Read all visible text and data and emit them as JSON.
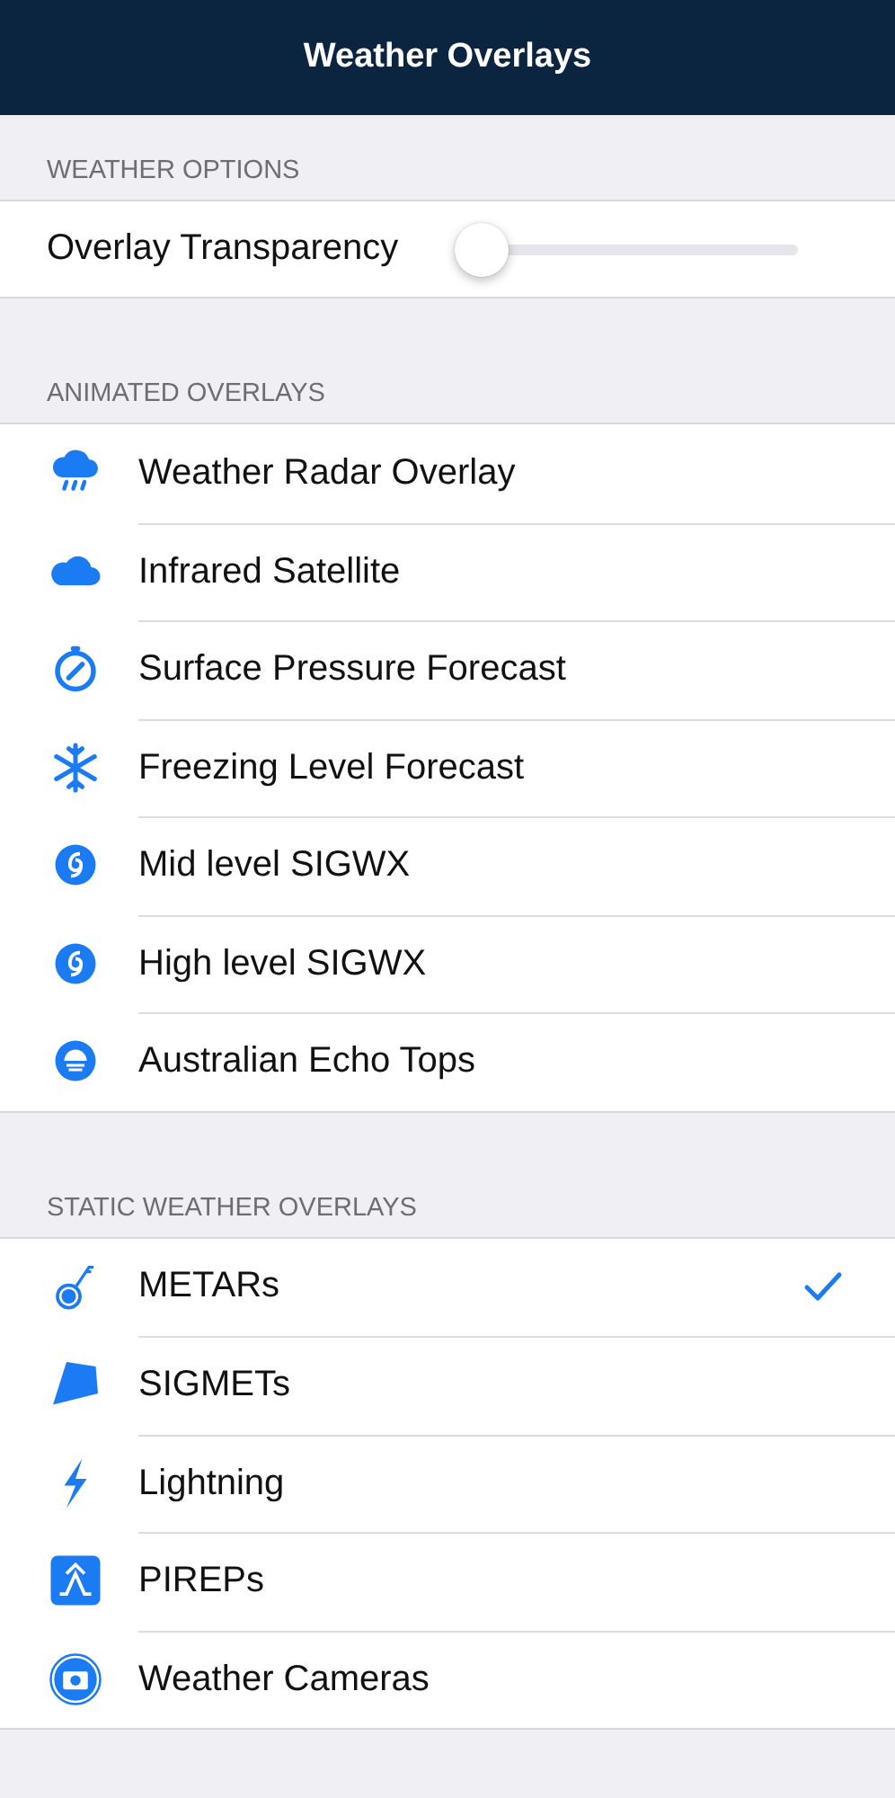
{
  "nav_bar": {
    "title": "Weather Overlays"
  },
  "weather_options": {
    "header": "WEATHER OPTIONS",
    "transparency": {
      "label": "Overlay Transparency",
      "level": 0
    }
  },
  "animated_overlays": {
    "header": "ANIMATED OVERLAYS",
    "items": [
      {
        "label": "Weather Radar Overlay",
        "kind": "rain",
        "checked": false
      },
      {
        "label": "Infrared Satellite",
        "kind": "cloud",
        "checked": false
      },
      {
        "label": "Surface Pressure Forecast",
        "kind": "gauge",
        "checked": false
      },
      {
        "label": "Freezing Level Forecast",
        "kind": "snow",
        "checked": false
      },
      {
        "label": "Mid level SIGWX",
        "kind": "swirl",
        "checked": false
      },
      {
        "label": "High level SIGWX",
        "kind": "swirl",
        "checked": false
      },
      {
        "label": "Australian Echo Tops",
        "kind": "echo",
        "checked": false
      }
    ]
  },
  "static_overlays": {
    "header": "STATIC WEATHER OVERLAYS",
    "items": [
      {
        "label": "METARs",
        "kind": "station",
        "checked": true
      },
      {
        "label": "SIGMETs",
        "kind": "polygon",
        "checked": false
      },
      {
        "label": "Lightning",
        "kind": "bolt",
        "checked": false
      },
      {
        "label": "PIREPs",
        "kind": "pirep",
        "checked": false
      },
      {
        "label": "Weather Cameras",
        "kind": "camera",
        "checked": false
      }
    ]
  }
}
